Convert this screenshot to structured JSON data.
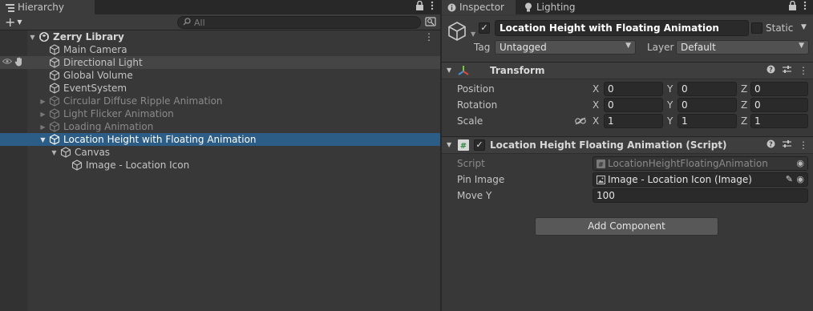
{
  "hierarchy": {
    "tab_label": "Hierarchy",
    "add_symbol": "+",
    "search_placeholder": "All",
    "scene_name": "Zerry Library",
    "items": [
      {
        "label": "Main Camera",
        "depth": 1,
        "state": "normal",
        "expander": "none"
      },
      {
        "label": "Directional Light",
        "depth": 1,
        "state": "hover",
        "expander": "none"
      },
      {
        "label": "Global Volume",
        "depth": 1,
        "state": "normal",
        "expander": "none"
      },
      {
        "label": "EventSystem",
        "depth": 1,
        "state": "normal",
        "expander": "none"
      },
      {
        "label": "Circular Diffuse Ripple Animation",
        "depth": 1,
        "state": "inactive",
        "expander": "collapsed"
      },
      {
        "label": "Light Flicker Animation",
        "depth": 1,
        "state": "inactive",
        "expander": "collapsed"
      },
      {
        "label": "Loading Animation",
        "depth": 1,
        "state": "inactive",
        "expander": "collapsed"
      },
      {
        "label": "Location Height with Floating Animation",
        "depth": 1,
        "state": "selected",
        "expander": "expanded"
      },
      {
        "label": "Canvas",
        "depth": 2,
        "state": "normal",
        "expander": "expanded"
      },
      {
        "label": "Image - Location Icon",
        "depth": 3,
        "state": "normal",
        "expander": "none"
      }
    ]
  },
  "inspector": {
    "tab_label": "Inspector",
    "lighting_tab_label": "Lighting",
    "object_name": "Location Height with Floating Animation",
    "active": true,
    "static_label": "Static",
    "static_checked": false,
    "tag_label": "Tag",
    "tag_value": "Untagged",
    "layer_label": "Layer",
    "layer_value": "Default",
    "transform": {
      "title": "Transform",
      "position_label": "Position",
      "rotation_label": "Rotation",
      "scale_label": "Scale",
      "position": {
        "x": "0",
        "y": "0",
        "z": "0"
      },
      "rotation": {
        "x": "0",
        "y": "0",
        "z": "0"
      },
      "scale": {
        "x": "1",
        "y": "1",
        "z": "1"
      },
      "axis_x": "X",
      "axis_y": "Y",
      "axis_z": "Z"
    },
    "script_component": {
      "title": "Location Height Floating Animation (Script)",
      "enabled": true,
      "script_label": "Script",
      "script_value": "LocationHeightFloatingAnimation",
      "pin_image_label": "Pin Image",
      "pin_image_value": "Image - Location Icon (Image)",
      "move_y_label": "Move Y",
      "move_y_value": "100"
    },
    "add_component_label": "Add Component"
  },
  "colors": {
    "selection": "#2c5d87",
    "panel": "#383838",
    "field": "#2a2a2a",
    "text": "#c4c4c4"
  },
  "icons": [
    "hierarchy-icon",
    "lock-icon",
    "kebab-menu-icon",
    "search-icon",
    "scene-visibility-icon",
    "unity-scene-icon",
    "gameobject-cube-icon",
    "eye-icon",
    "pick-hand-icon",
    "info-icon",
    "lighting-bulb-icon",
    "transform-axes-icon",
    "help-icon",
    "preset-icon",
    "constrain-link-icon",
    "script-hash-icon",
    "image-icon",
    "object-picker-icon",
    "pen-icon"
  ]
}
